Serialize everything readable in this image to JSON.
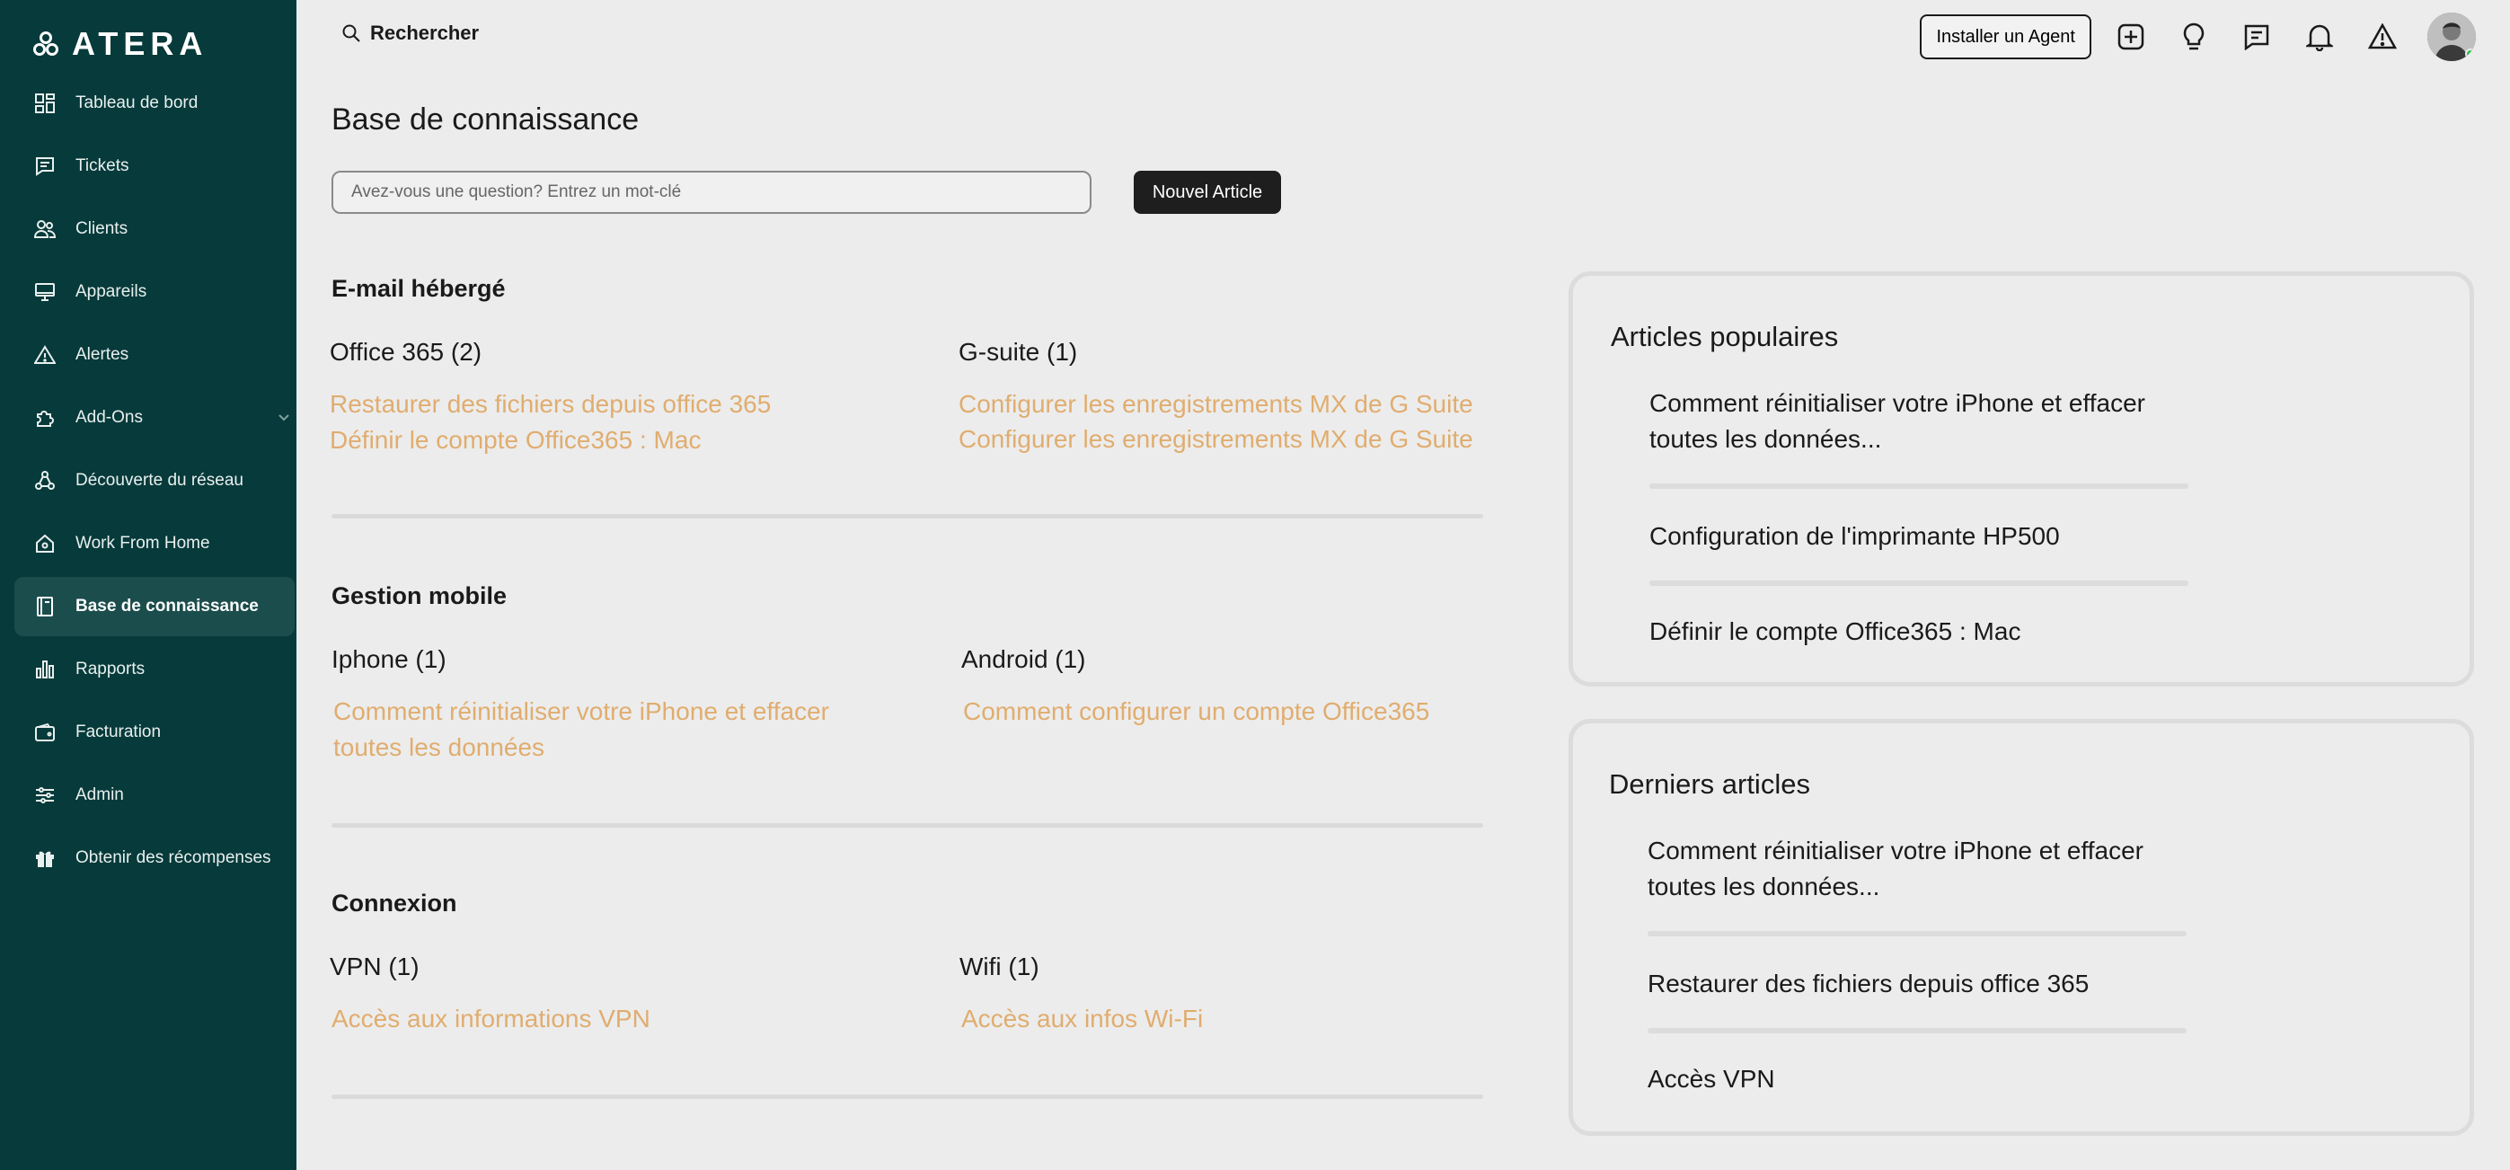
{
  "app": {
    "logo_text": "ATERA"
  },
  "sidebar": {
    "items": [
      {
        "label": "Tableau de bord",
        "icon": "dashboard-icon"
      },
      {
        "label": "Tickets",
        "icon": "ticket-icon"
      },
      {
        "label": "Clients",
        "icon": "users-icon"
      },
      {
        "label": "Appareils",
        "icon": "monitor-icon"
      },
      {
        "label": "Alertes",
        "icon": "alert-icon"
      },
      {
        "label": "Add-Ons",
        "icon": "puzzle-icon"
      },
      {
        "label": "Découverte du réseau",
        "icon": "network-icon"
      },
      {
        "label": "Work From Home",
        "icon": "home-icon"
      },
      {
        "label": "Base de connaissance",
        "icon": "book-icon",
        "active": true
      },
      {
        "label": "Rapports",
        "icon": "bar-chart-icon"
      },
      {
        "label": "Facturation",
        "icon": "wallet-icon"
      },
      {
        "label": "Admin",
        "icon": "sliders-icon"
      },
      {
        "label": "Obtenir des récompenses",
        "icon": "gift-icon"
      }
    ]
  },
  "topbar": {
    "search_label": "Rechercher",
    "install_agent_label": "Installer un Agent"
  },
  "main": {
    "title": "Base de connaissance",
    "search_placeholder": "Avez-vous une question? Entrez un mot-clé",
    "new_article_label": "Nouvel Article",
    "sections": [
      {
        "title": "E-mail hébergé",
        "columns": [
          {
            "title": "Office 365 (2)",
            "links": [
              "Restaurer des fichiers depuis office 365",
              "Définir le compte Office365 : Mac"
            ]
          },
          {
            "title": "G-suite (1)",
            "links": [
              "Configurer les enregistrements MX de G Suite",
              "Configurer les enregistrements MX de G Suite"
            ]
          }
        ]
      },
      {
        "title": "Gestion mobile",
        "columns": [
          {
            "title": "Iphone (1)",
            "links": [
              "Comment réinitialiser votre iPhone et effacer toutes les données"
            ]
          },
          {
            "title": "Android (1)",
            "links": [
              "Comment configurer un compte Office365"
            ]
          }
        ]
      },
      {
        "title": "Connexion",
        "columns": [
          {
            "title": "VPN (1)",
            "links": [
              "Accès aux informations VPN"
            ]
          },
          {
            "title": "Wifi (1)",
            "links": [
              "Accès aux infos Wi-Fi"
            ]
          }
        ]
      }
    ]
  },
  "popular": {
    "title": "Articles populaires",
    "items": [
      "Comment réinitialiser votre iPhone et effacer toutes les données...",
      "Configuration de l'imprimante HP500",
      "Définir le compte Office365 : Mac"
    ]
  },
  "latest": {
    "title": "Derniers articles",
    "items": [
      "Comment réinitialiser votre iPhone et effacer toutes les données...",
      "Restaurer des fichiers depuis office 365",
      "Accès VPN"
    ]
  },
  "colors": {
    "sidebar_bg": "#073a3a",
    "active_item_bg": "#1b4d4c",
    "link": "#e0ad6f",
    "background": "#ececec"
  }
}
